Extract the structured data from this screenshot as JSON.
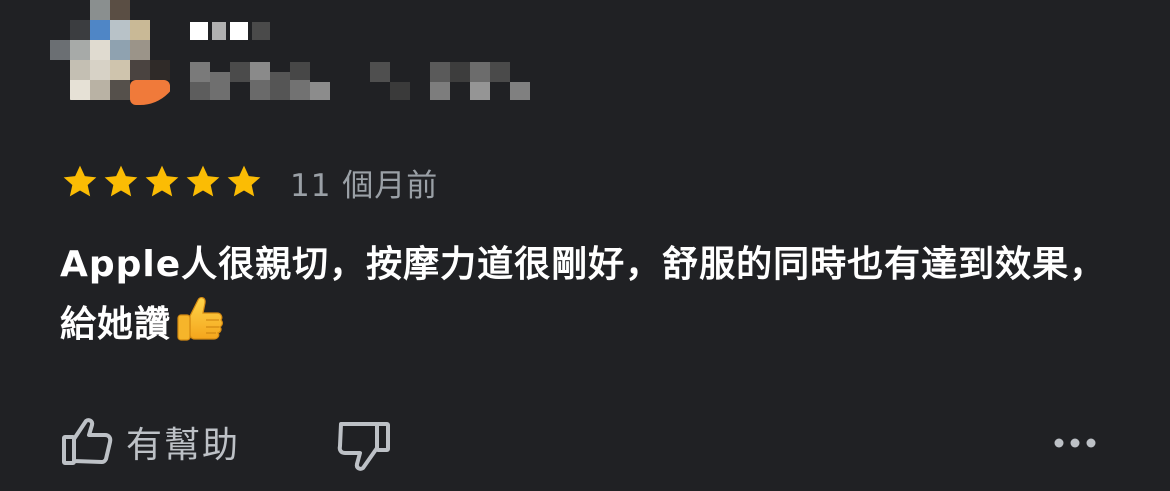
{
  "review": {
    "rating": 5,
    "rating_max": 5,
    "date": "11 個月前",
    "text": "Apple人很親切，按摩力道很剛好，舒服的同時也有達到效果，給她讚",
    "emoji": "thumbs-up-emoji"
  },
  "actions": {
    "helpful_label": "有幫助",
    "helpful_icon": "thumbs-up-outline-icon",
    "unhelpful_icon": "thumbs-down-outline-icon",
    "more_icon": "more-horizontal-icon"
  },
  "colors": {
    "background": "#202124",
    "star": "#fbbc04",
    "text_primary": "#ffffff",
    "text_secondary": "#9aa0a6",
    "icon": "#bdc1c6"
  }
}
